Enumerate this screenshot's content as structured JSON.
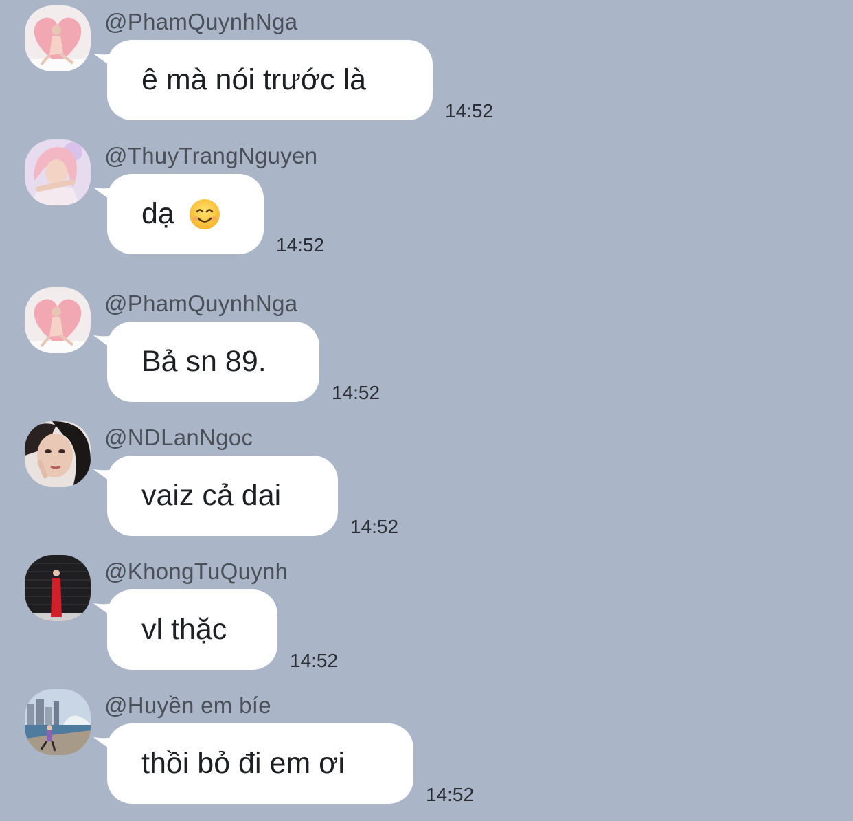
{
  "messages": [
    {
      "sender": "@PhamQuynhNga",
      "text": "ê mà nói trước là",
      "time": "14:52",
      "avatar": "avatar-pink-heart"
    },
    {
      "sender": "@ThuyTrangNguyen",
      "text": "dạ",
      "emoji": "smiling-face-emoji",
      "time": "14:52",
      "avatar": "avatar-pink-hair"
    },
    {
      "sender": "@PhamQuynhNga",
      "text": "Bả sn 89.",
      "time": "14:52",
      "avatar": "avatar-pink-heart"
    },
    {
      "sender": "@NDLanNgoc",
      "text": "vaiz cả dai",
      "time": "14:52",
      "avatar": "avatar-portrait"
    },
    {
      "sender": "@KhongTuQuynh",
      "text": "vl thặc",
      "time": "14:52",
      "avatar": "avatar-red-dress"
    },
    {
      "sender": "@Huyền em bíe",
      "text": "thồi bỏ đi em ơi",
      "time": "14:52",
      "avatar": "avatar-city-harbor"
    }
  ],
  "colors": {
    "background": "#aab6c8",
    "bubble": "#ffffff",
    "sender_text": "#4a4f58",
    "message_text": "#1d1f23"
  }
}
